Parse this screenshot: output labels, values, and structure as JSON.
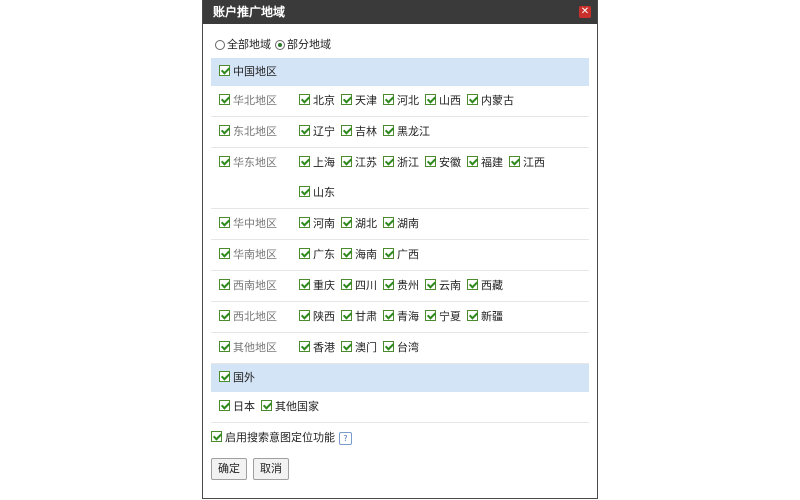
{
  "dialog": {
    "title": "账户推广地域",
    "close_glyph": "✕"
  },
  "scope": {
    "all_label": "全部地域",
    "partial_label": "部分地域",
    "selected": "partial"
  },
  "china": {
    "label": "中国地区",
    "regions": [
      {
        "name": "华北地区",
        "provinces": [
          "北京",
          "天津",
          "河北",
          "山西",
          "内蒙古"
        ]
      },
      {
        "name": "东北地区",
        "provinces": [
          "辽宁",
          "吉林",
          "黑龙江"
        ]
      },
      {
        "name": "华东地区",
        "provinces": [
          "上海",
          "江苏",
          "浙江",
          "安徽",
          "福建",
          "江西",
          "山东"
        ]
      },
      {
        "name": "华中地区",
        "provinces": [
          "河南",
          "湖北",
          "湖南"
        ]
      },
      {
        "name": "华南地区",
        "provinces": [
          "广东",
          "海南",
          "广西"
        ]
      },
      {
        "name": "西南地区",
        "provinces": [
          "重庆",
          "四川",
          "贵州",
          "云南",
          "西藏"
        ]
      },
      {
        "name": "西北地区",
        "provinces": [
          "陕西",
          "甘肃",
          "青海",
          "宁夏",
          "新疆"
        ]
      },
      {
        "name": "其他地区",
        "provinces": [
          "香港",
          "澳门",
          "台湾"
        ]
      }
    ]
  },
  "foreign": {
    "label": "国外",
    "countries": [
      "日本",
      "其他国家"
    ]
  },
  "geo_option": {
    "label": "启用搜索意图定位功能",
    "help_glyph": "?"
  },
  "buttons": {
    "confirm": "确定",
    "cancel": "取消"
  }
}
